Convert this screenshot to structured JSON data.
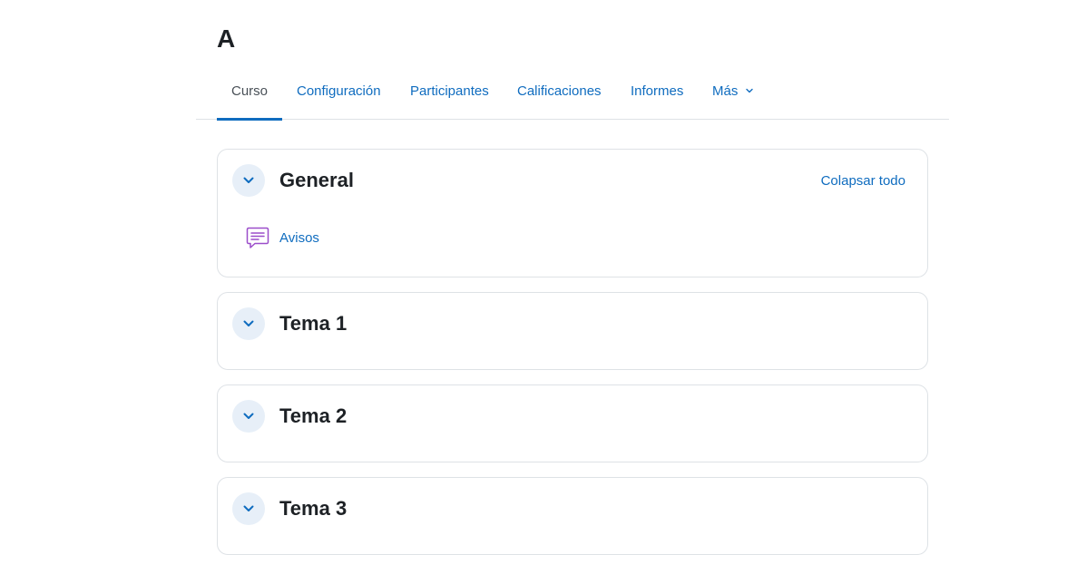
{
  "course": {
    "title": "A"
  },
  "tabs": [
    {
      "label": "Curso",
      "active": true
    },
    {
      "label": "Configuración"
    },
    {
      "label": "Participantes"
    },
    {
      "label": "Calificaciones"
    },
    {
      "label": "Informes"
    },
    {
      "label": "Más"
    }
  ],
  "sections": [
    {
      "title": "General",
      "action": "Colapsar todo",
      "activities": [
        {
          "label": "Avisos",
          "icon": "forum-icon"
        }
      ]
    },
    {
      "title": "Tema 1",
      "activities": []
    },
    {
      "title": "Tema 2",
      "activities": []
    },
    {
      "title": "Tema 3",
      "activities": []
    }
  ],
  "colors": {
    "link": "#0f6cbf",
    "toggle_bg": "#e7eff8",
    "forum_icon": "#9b4dca",
    "border": "#dee2e6"
  }
}
